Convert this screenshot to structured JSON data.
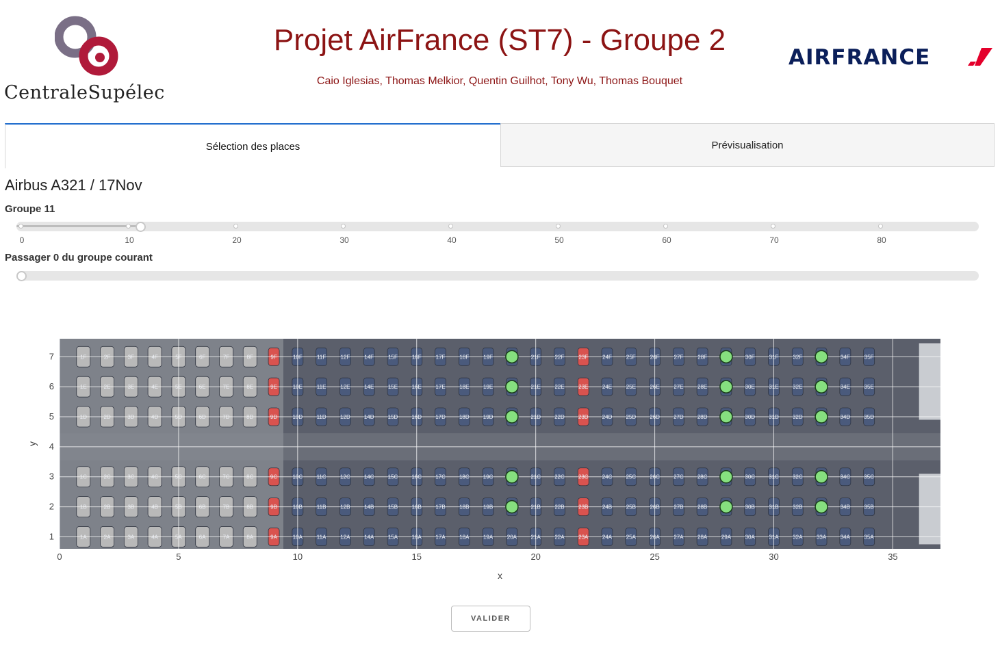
{
  "header": {
    "title": "Projet AirFrance (ST7) - Groupe 2",
    "authors": "Caio Iglesias, Thomas Melkior, Quentin Guilhot, Tony Wu, Thomas Bouquet",
    "school_logo_text": "CentraleSupélec",
    "airline_logo_text": "AIRFRANCE",
    "title_color": "#8c1414"
  },
  "tabs": [
    {
      "label": "Sélection des places",
      "active": true
    },
    {
      "label": "Prévisualisation",
      "active": false
    }
  ],
  "aircraft_label": "Airbus A321 / 17Nov",
  "group_slider": {
    "label": "Groupe 11",
    "value": 11,
    "min": 0,
    "max": 89,
    "marks": [
      "0",
      "10",
      "20",
      "30",
      "40",
      "50",
      "60",
      "70",
      "80"
    ]
  },
  "passenger_slider": {
    "label": "Passager 0 du groupe courant",
    "value": 0
  },
  "chart_data": {
    "type": "scatter",
    "xlabel": "x",
    "ylabel": "y",
    "xlim": [
      0,
      37
    ],
    "ylim": [
      0.6,
      7.6
    ],
    "xticks": [
      "0",
      "5",
      "10",
      "15",
      "20",
      "25",
      "30",
      "35"
    ],
    "yticks": [
      "1",
      "2",
      "3",
      "4",
      "5",
      "6",
      "7"
    ],
    "grid": true,
    "marker_color": "#86e07f",
    "points": [
      {
        "x": 19,
        "y": 7
      },
      {
        "x": 19,
        "y": 6
      },
      {
        "x": 19,
        "y": 5
      },
      {
        "x": 19,
        "y": 3
      },
      {
        "x": 19,
        "y": 2
      },
      {
        "x": 28,
        "y": 7
      },
      {
        "x": 28,
        "y": 6
      },
      {
        "x": 28,
        "y": 5
      },
      {
        "x": 28,
        "y": 3
      },
      {
        "x": 28,
        "y": 2
      },
      {
        "x": 32,
        "y": 7
      },
      {
        "x": 32,
        "y": 6
      },
      {
        "x": 32,
        "y": 5
      },
      {
        "x": 32,
        "y": 3
      },
      {
        "x": 32,
        "y": 2
      }
    ],
    "seat_map": {
      "rows": [
        1,
        2,
        3,
        4,
        5,
        6,
        7,
        8,
        9,
        10,
        11,
        12,
        14,
        15,
        16,
        17,
        18,
        19,
        20,
        21,
        22,
        23,
        24,
        25,
        26,
        27,
        28,
        29,
        30,
        31,
        32,
        33,
        34,
        35
      ],
      "business_rows": [
        1,
        2,
        3,
        4,
        5,
        6,
        7,
        8
      ],
      "exit_rows": [
        9,
        23
      ],
      "letters_upper": [
        "F",
        "E",
        "D"
      ],
      "letters_lower": [
        "C",
        "B",
        "A"
      ]
    }
  },
  "button": {
    "label": "VALIDER"
  }
}
